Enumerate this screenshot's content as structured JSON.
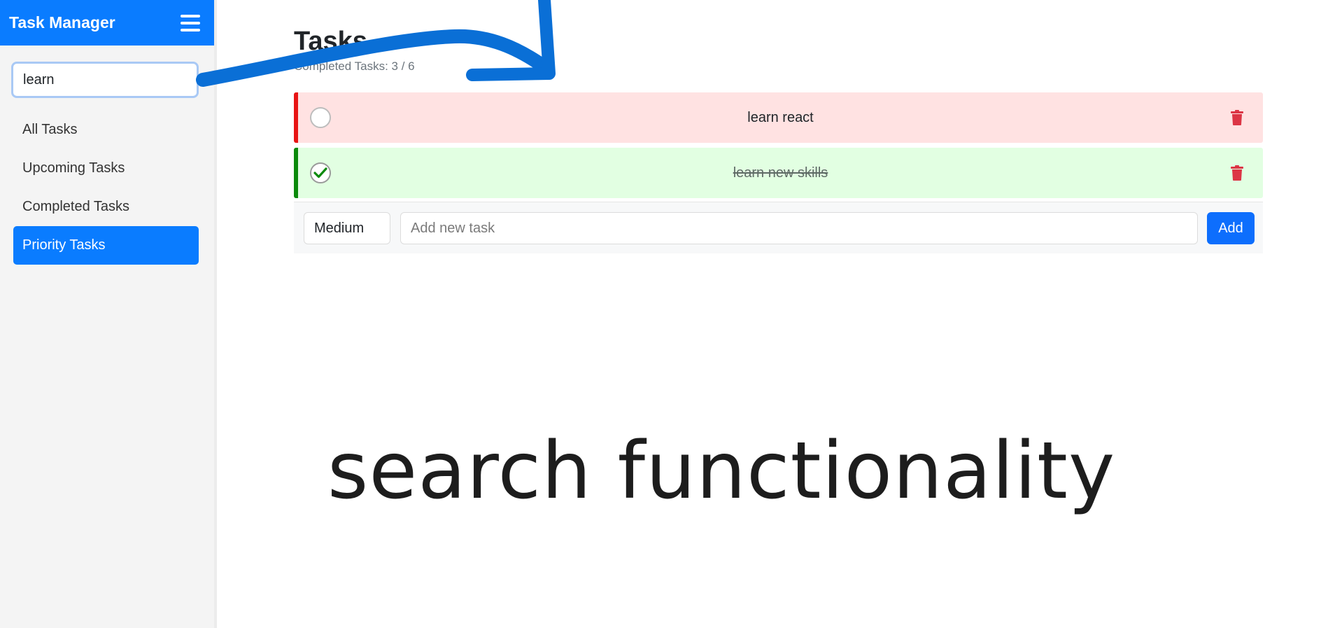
{
  "sidebar": {
    "title": "Task Manager",
    "search": {
      "value": "learn"
    },
    "nav": [
      {
        "label": "All Tasks",
        "active": false
      },
      {
        "label": "Upcoming Tasks",
        "active": false
      },
      {
        "label": "Completed Tasks",
        "active": false
      },
      {
        "label": "Priority Tasks",
        "active": true
      }
    ]
  },
  "main": {
    "title": "Tasks",
    "completed_summary": "Completed Tasks: 3 / 6",
    "tasks": [
      {
        "text": "learn react",
        "completed": false,
        "priority_color": "#e81414"
      },
      {
        "text": "learn new skills",
        "completed": true,
        "priority_color": "#0c8a0c"
      }
    ],
    "add_form": {
      "priority": "Medium",
      "placeholder": "Add new task",
      "button": "Add"
    }
  },
  "annotation": {
    "caption": "search functionality",
    "arrow_color": "#0a6fd6"
  },
  "colors": {
    "brand": "#0a7cff",
    "add_button": "#0d6efd",
    "delete_icon": "#dc3545",
    "check": "#0c8a0c"
  }
}
